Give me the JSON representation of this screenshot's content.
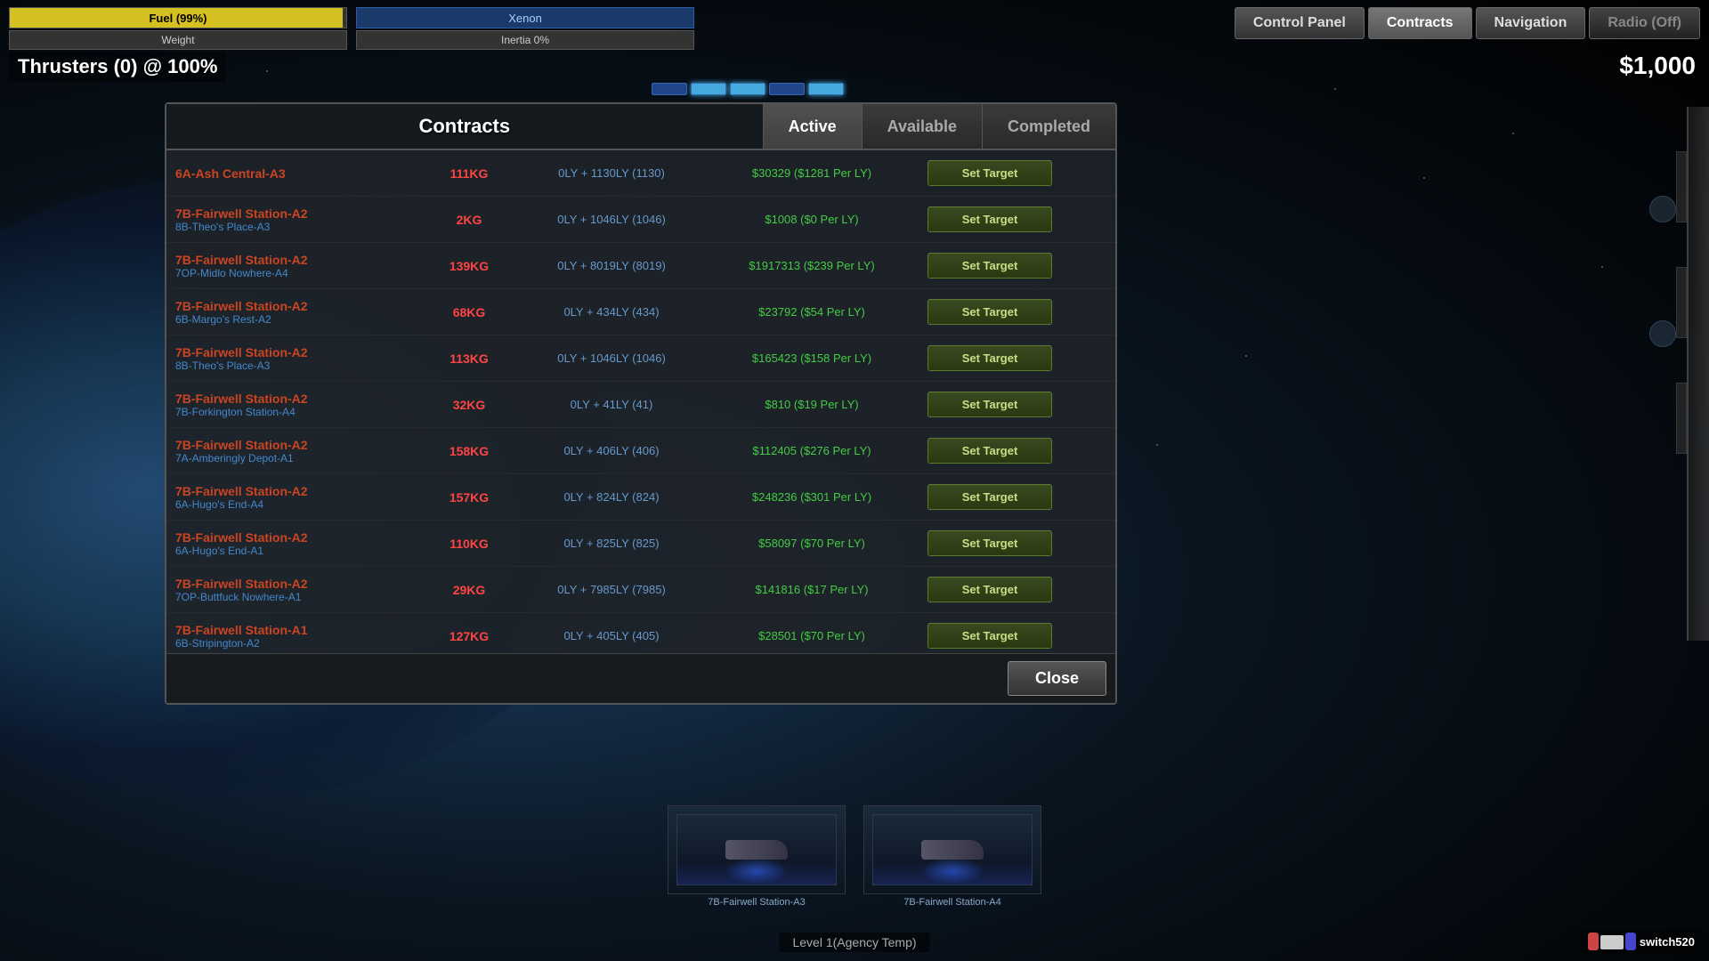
{
  "hud": {
    "fuel_label": "Fuel (99%)",
    "fuel_pct": 99,
    "weight_label": "Weight",
    "xenon_label": "Xenon",
    "inertia_label": "Inertia  0%",
    "thrusters_label": "Thrusters (0) @  100%",
    "money": "$1,000"
  },
  "nav_buttons": {
    "control_panel": "Control Panel",
    "contracts": "Contracts",
    "navigation": "Navigation",
    "radio": "Radio (Off)"
  },
  "contracts_panel": {
    "title": "Contracts",
    "tabs": {
      "active": "Active",
      "available": "Available",
      "completed": "Completed"
    },
    "active_tab": "active"
  },
  "contracts": [
    {
      "from": "6A-Ash Central-A3",
      "to": "",
      "weight": "111KG",
      "distance": "0LY + 1130LY  (1130)",
      "reward": "$30329  ($1281 Per LY)",
      "btn": "Set Target"
    },
    {
      "from": "7B-Fairwell Station-A2",
      "to": "8B-Theo's Place-A3",
      "weight": "2KG",
      "distance": "0LY + 1046LY  (1046)",
      "reward": "$1008  ($0 Per LY)",
      "btn": "Set Target"
    },
    {
      "from": "7B-Fairwell Station-A2",
      "to": "7OP-Midlo Nowhere-A4",
      "weight": "139KG",
      "distance": "0LY + 8019LY  (8019)",
      "reward": "$1917313  ($239 Per LY)",
      "btn": "Set Target"
    },
    {
      "from": "7B-Fairwell Station-A2",
      "to": "6B-Margo's Rest-A2",
      "weight": "68KG",
      "distance": "0LY + 434LY  (434)",
      "reward": "$23792  ($54 Per LY)",
      "btn": "Set Target"
    },
    {
      "from": "7B-Fairwell Station-A2",
      "to": "8B-Theo's Place-A3",
      "weight": "113KG",
      "distance": "0LY + 1046LY  (1046)",
      "reward": "$165423  ($158 Per LY)",
      "btn": "Set Target"
    },
    {
      "from": "7B-Fairwell Station-A2",
      "to": "7B-Forkington Station-A4",
      "weight": "32KG",
      "distance": "0LY + 41LY  (41)",
      "reward": "$810  ($19 Per LY)",
      "btn": "Set Target"
    },
    {
      "from": "7B-Fairwell Station-A2",
      "to": "7A-Amberingly Depot-A1",
      "weight": "158KG",
      "distance": "0LY + 406LY  (406)",
      "reward": "$112405  ($276 Per LY)",
      "btn": "Set Target"
    },
    {
      "from": "7B-Fairwell Station-A2",
      "to": "6A-Hugo's End-A4",
      "weight": "157KG",
      "distance": "0LY + 824LY  (824)",
      "reward": "$248236  ($301 Per LY)",
      "btn": "Set Target"
    },
    {
      "from": "7B-Fairwell Station-A2",
      "to": "6A-Hugo's End-A1",
      "weight": "110KG",
      "distance": "0LY + 825LY  (825)",
      "reward": "$58097  ($70 Per LY)",
      "btn": "Set Target"
    },
    {
      "from": "7B-Fairwell Station-A2",
      "to": "7OP-Buttfuck Nowhere-A1",
      "weight": "29KG",
      "distance": "0LY + 7985LY  (7985)",
      "reward": "$141816  ($17 Per LY)",
      "btn": "Set Target"
    },
    {
      "from": "7B-Fairwell Station-A1",
      "to": "6B-Stripington-A2",
      "weight": "127KG",
      "distance": "0LY + 405LY  (405)",
      "reward": "$28501  ($70 Per LY)",
      "btn": "Set Target"
    }
  ],
  "close_btn": "Close",
  "level_bar": "Level 1(Agency Temp)",
  "ship_labels": [
    "7B-Fairwell Station-A3",
    "7B-Fairwell Station-A4"
  ],
  "switch": "switch520"
}
